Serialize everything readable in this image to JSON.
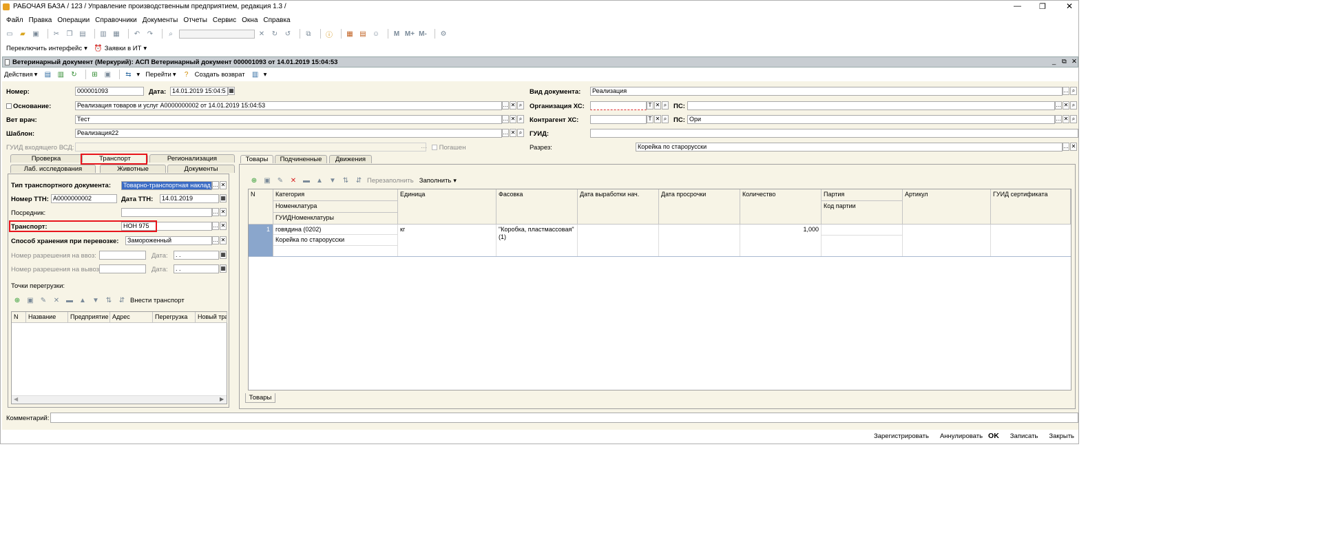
{
  "window": {
    "title": "РАБОЧАЯ БАЗА / 123 /  Управление производственным предприятием, редакция 1.3 /",
    "controls": [
      "minimize-icon",
      "restore-icon",
      "close-icon"
    ]
  },
  "menu": [
    "Файл",
    "Правка",
    "Операции",
    "Справочники",
    "Документы",
    "Отчеты",
    "Сервис",
    "Окна",
    "Справка"
  ],
  "toolbar2": {
    "switch_interface": "Переключить интерфейс",
    "requests": "Заявки в ИТ"
  },
  "document": {
    "title": "Ветеринарный документ (Меркурий): АСП Ветеринарный документ 000001093 от 14.01.2019 15:04:53"
  },
  "actions": {
    "actions": "Действия",
    "goto": "Перейти",
    "create_return": "Создать возврат"
  },
  "header": {
    "number_label": "Номер:",
    "number": "000001093",
    "date_label": "Дата:",
    "date": "14.01.2019 15:04:5",
    "doc_type_label": "Вид документа:",
    "doc_type": "Реализация",
    "basis_label": "Основание:",
    "basis": "Реализация товаров и услуг А0000000002 от 14.01.2019 15:04:53",
    "org_label": "Организация ХС:",
    "org": "",
    "ps_label": "ПС:",
    "ps": "",
    "vet_label": "Вет врач:",
    "vet": "Тест",
    "contractor_label": "Контрагент ХС:",
    "contractor": "",
    "ps2_label": "ПС:",
    "ps2": "Ори",
    "template_label": "Шаблон:",
    "template": "Реализация22",
    "guid_label": "ГУИД:",
    "guid": "",
    "incoming_guid_label": "ГУИД входящего ВСД:",
    "repaid_label": "Погашен",
    "section_label": "Разрез:",
    "section": "Корейка по старорусски"
  },
  "left_tabs": {
    "row1": [
      "Проверка",
      "Транспорт",
      "Регионализация"
    ],
    "row2": [
      "Лаб. исследования",
      "Животные",
      "Документы"
    ]
  },
  "transport": {
    "doc_type_label": "Тип транспортного документа:",
    "doc_type": "Товарно-транспортная наклад",
    "ttn_number_label": "Номер ТТН:",
    "ttn_number": "А0000000002",
    "ttn_date_label": "Дата ТТН:",
    "ttn_date": "14.01.2019",
    "mediator_label": "Посредник:",
    "mediator": "",
    "transport_label": "Транспорт:",
    "transport": "НОН 975",
    "storage_label": "Способ хранения при перевозке:",
    "storage": "Замороженный",
    "import_label": "Номер разрешения на ввоз:",
    "import_date_label": "Дата:",
    "import_date": " .  .",
    "export_label": "Номер разрешения на вывоз:",
    "export_date_label": "Дата:",
    "export_date": " .  .",
    "points_label": "Точки перегрузки:",
    "add_transport": "Внести транспорт",
    "columns": [
      "N",
      "Название",
      "Предприятие",
      "Адрес",
      "Перегрузка",
      "Новый тра"
    ]
  },
  "right_tabs": [
    "Товары",
    "Подчиненные",
    "Движения"
  ],
  "goods_toolbar": {
    "refill": "Перезаполнить",
    "fill": "Заполнить"
  },
  "goods": {
    "columns": {
      "n": "N",
      "category": "Категория",
      "nomenclature": "Номенклатура",
      "guid_nom": "ГУИДНоменклатуры",
      "unit": "Единица",
      "packing": "Фасовка",
      "prod_date": "Дата выработки нач.",
      "expiry": "Дата просрочки",
      "qty": "Количество",
      "batch": "Партия",
      "batch_code": "Код партии",
      "article": "Артикул",
      "cert_guid": "ГУИД сертификата"
    },
    "rows": [
      {
        "n": "1",
        "category": "говядина (0202)",
        "nomenclature": "Корейка по старорусски",
        "unit": "кг",
        "packing": "\"Коробка, пластмассовая\"(1)",
        "qty": "1,000"
      }
    ]
  },
  "bottom_tab": "Товары",
  "comment_label": "Комментарий:",
  "footer": [
    "Зарегистрировать",
    "Аннулировать",
    "OK",
    "Записать",
    "Закрыть"
  ]
}
